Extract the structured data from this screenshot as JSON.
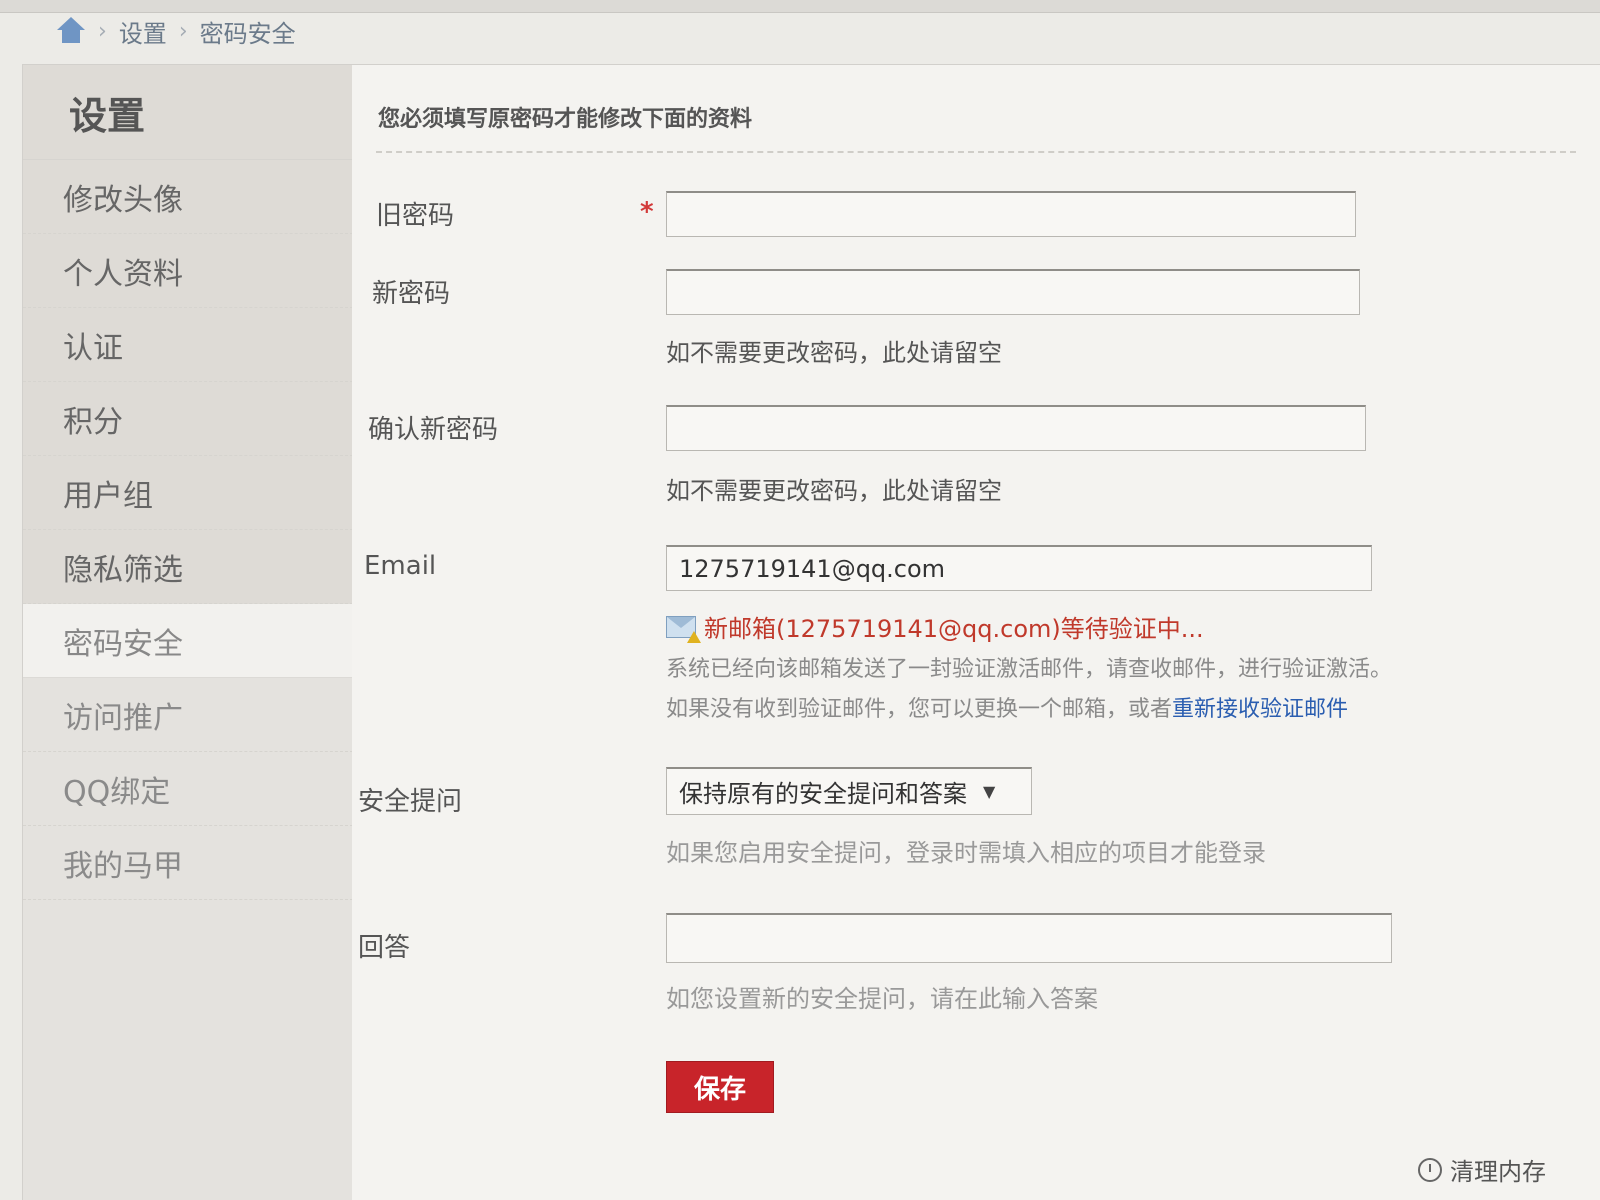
{
  "breadcrumb": {
    "icon": "home-icon",
    "items": [
      "设置",
      "密码安全"
    ]
  },
  "sidebar": {
    "title": "设置",
    "items": [
      {
        "label": "修改头像"
      },
      {
        "label": "个人资料"
      },
      {
        "label": "认证"
      },
      {
        "label": "积分"
      },
      {
        "label": "用户组"
      },
      {
        "label": "隐私筛选"
      },
      {
        "label": "密码安全"
      },
      {
        "label": "访问推广"
      },
      {
        "label": "QQ绑定"
      },
      {
        "label": "我的马甲"
      }
    ]
  },
  "form": {
    "notice": "您必须填写原密码才能修改下面的资料",
    "old_password": {
      "label": "旧密码",
      "required": "*",
      "value": ""
    },
    "new_password": {
      "label": "新密码",
      "value": "",
      "hint": "如不需要更改密码，此处请留空"
    },
    "confirm_password": {
      "label": "确认新密码",
      "value": "",
      "hint": "如不需要更改密码，此处请留空"
    },
    "email": {
      "label": "Email",
      "value": "1275719141@qq.com",
      "pending_icon": "mail-warning-icon",
      "pending": "新邮箱(1275719141@qq.com)等待验证中...",
      "info_line1": "系统已经向该邮箱发送了一封验证激活邮件，请查收邮件，进行验证激活。",
      "info_line2_prefix": "如果没有收到验证邮件，您可以更换一个邮箱，或者",
      "info_link": "重新接收验证邮件"
    },
    "security_question": {
      "label": "安全提问",
      "selected": "保持原有的安全提问和答案",
      "hint": "如果您启用安全提问，登录时需填入相应的项目才能登录"
    },
    "answer": {
      "label": "回答",
      "value": "",
      "hint": "如您设置新的安全提问，请在此输入答案"
    },
    "save_label": "保存"
  },
  "footer": {
    "clear_memory": "清理内存",
    "icon": "clock-icon"
  },
  "colors": {
    "accent_red": "#c8242a",
    "link_blue": "#2a5db0",
    "pending_red": "#c0392b"
  }
}
